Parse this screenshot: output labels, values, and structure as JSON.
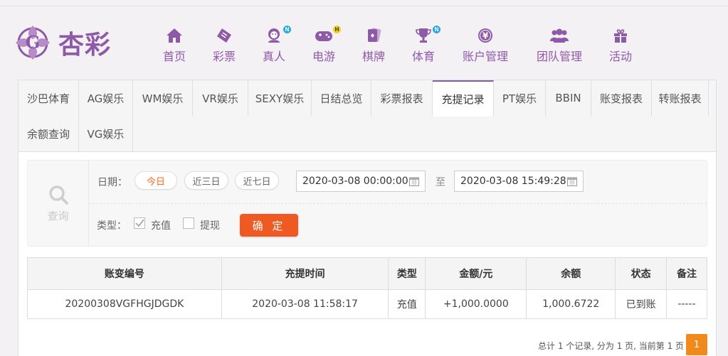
{
  "brand": {
    "name": "杏彩"
  },
  "nav": [
    {
      "label": "首页",
      "icon": "home-icon"
    },
    {
      "label": "彩票",
      "icon": "ticket-icon"
    },
    {
      "label": "真人",
      "icon": "live-dealer-icon",
      "badge": "N"
    },
    {
      "label": "电游",
      "icon": "gamepad-icon",
      "badge": "H"
    },
    {
      "label": "棋牌",
      "icon": "cards-icon"
    },
    {
      "label": "体育",
      "icon": "trophy-icon",
      "badge": "N"
    },
    {
      "label": "账户管理",
      "icon": "yen-coin-icon"
    },
    {
      "label": "团队管理",
      "icon": "team-icon"
    },
    {
      "label": "活动",
      "icon": "gift-icon"
    }
  ],
  "tabs": [
    "沙巴体育",
    "AG娱乐",
    "WM娱乐",
    "VR娱乐",
    "SEXY娱乐",
    "日结总览",
    "彩票报表",
    "充提记录",
    "PT娱乐",
    "BBIN",
    "账变报表",
    "转账报表",
    "余额查询",
    "VG娱乐"
  ],
  "active_tab": "充提记录",
  "query": {
    "side_label": "查询",
    "date_label": "日期：",
    "ranges": [
      "今日",
      "近三日",
      "近七日"
    ],
    "active_range": "今日",
    "start": "2020-03-08 00:00:00",
    "to_label": "至",
    "end": "2020-03-08 15:49:28",
    "type_label": "类型：",
    "types": [
      {
        "label": "充值",
        "checked": true
      },
      {
        "label": "提现",
        "checked": false
      }
    ],
    "submit_label": "确 定"
  },
  "table": {
    "headers": [
      "账变编号",
      "充提时间",
      "类型",
      "金额/元",
      "余额",
      "状态",
      "备注"
    ],
    "rows": [
      {
        "id": "20200308VGFHGJDGDK",
        "time": "2020-03-08 11:58:17",
        "type": "充值",
        "amount": "+1,000.0000",
        "balance": "1,000.6722",
        "status": "已到账",
        "note": "-----"
      }
    ]
  },
  "pagination": {
    "summary": "总计 1 个记录, 分为 1 页, 当前第 1 页",
    "current": "1"
  },
  "colors": {
    "brand_purple": "#8e5aa8",
    "accent_orange": "#ef5a23",
    "positive_red": "#e02020",
    "status_green": "#2f9e2f"
  }
}
